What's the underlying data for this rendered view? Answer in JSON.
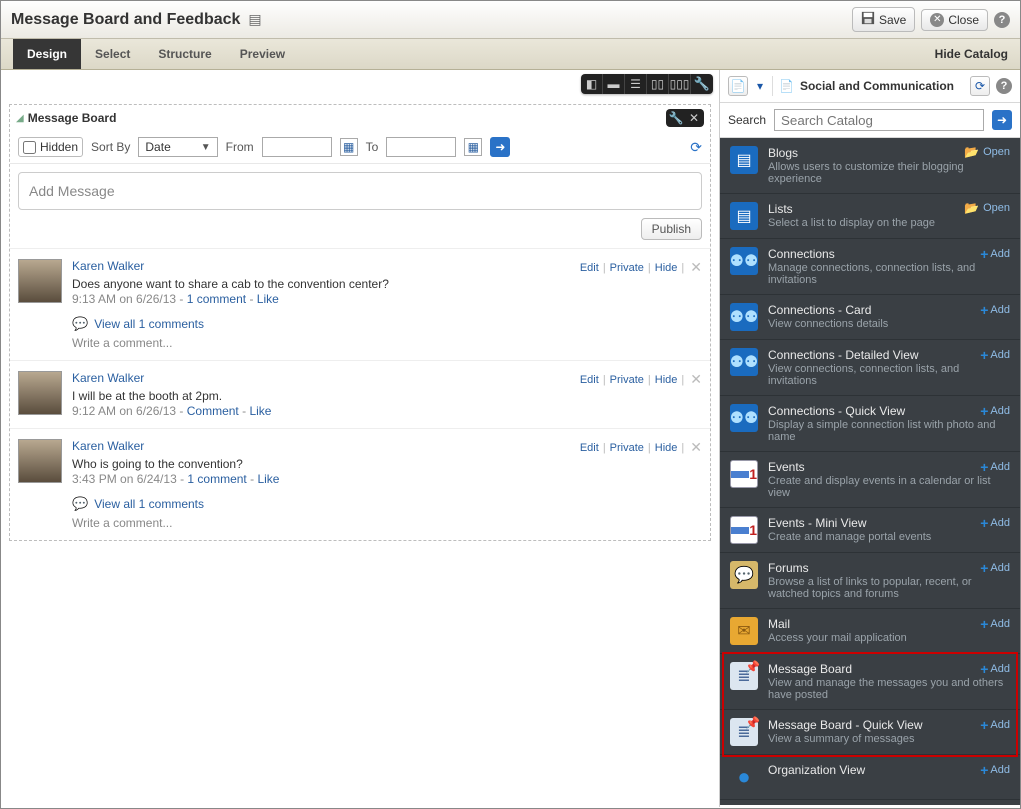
{
  "header": {
    "title": "Message Board and Feedback",
    "save": "Save",
    "close": "Close"
  },
  "tabs": {
    "items": [
      "Design",
      "Select",
      "Structure",
      "Preview"
    ],
    "hide_catalog": "Hide Catalog"
  },
  "panel": {
    "title": "Message Board",
    "hidden_label": "Hidden",
    "sortby_label": "Sort By",
    "sortby_value": "Date",
    "from_label": "From",
    "to_label": "To",
    "add_placeholder": "Add Message",
    "publish": "Publish"
  },
  "post_actions": {
    "edit": "Edit",
    "private": "Private",
    "hide": "Hide",
    "like": "Like",
    "comment": "Comment",
    "view_all": "View all 1 comments",
    "one_comment": "1 comment",
    "write": "Write a comment..."
  },
  "posts": [
    {
      "author": "Karen Walker",
      "body": "Does anyone want to share a cab to the convention center?",
      "time": "9:13 AM on 6/26/13",
      "has_comments": true
    },
    {
      "author": "Karen Walker",
      "body": "I will be at the booth at 2pm.",
      "time": "9:12 AM on 6/26/13",
      "has_comments": false
    },
    {
      "author": "Karen Walker",
      "body": "Who is going to the convention?",
      "time": "3:43 PM on 6/24/13",
      "has_comments": true
    }
  ],
  "catalog": {
    "title": "Social and Communication",
    "search_label": "Search",
    "search_placeholder": "Search Catalog",
    "open": "Open",
    "add": "Add",
    "items": [
      {
        "name": "Blogs",
        "desc": "Allows users to customize their blogging experience",
        "action": "open",
        "icon": "blue"
      },
      {
        "name": "Lists",
        "desc": "Select a list to display on the page",
        "action": "open",
        "icon": "blue"
      },
      {
        "name": "Connections",
        "desc": "Manage connections, connection lists, and invitations",
        "action": "add",
        "icon": "people"
      },
      {
        "name": "Connections - Card",
        "desc": "View connections details",
        "action": "add",
        "icon": "people"
      },
      {
        "name": "Connections - Detailed View",
        "desc": "View connections, connection lists, and invitations",
        "action": "add",
        "icon": "people"
      },
      {
        "name": "Connections - Quick View",
        "desc": "Display a simple connection list with photo and name",
        "action": "add",
        "icon": "people"
      },
      {
        "name": "Events",
        "desc": "Create and display events in a calendar or list view",
        "action": "add",
        "icon": "cal"
      },
      {
        "name": "Events - Mini View",
        "desc": "Create and manage portal events",
        "action": "add",
        "icon": "cal"
      },
      {
        "name": "Forums",
        "desc": "Browse a list of links to popular, recent, or watched topics and forums",
        "action": "add",
        "icon": "forum"
      },
      {
        "name": "Mail",
        "desc": "Access your mail application",
        "action": "add",
        "icon": "mail"
      },
      {
        "name": "Message Board",
        "desc": "View and manage the messages you and others have posted",
        "action": "add",
        "icon": "doc"
      },
      {
        "name": "Message Board - Quick View",
        "desc": "View a summary of messages",
        "action": "add",
        "icon": "doc"
      },
      {
        "name": "Organization View",
        "desc": "",
        "action": "add",
        "icon": "person"
      }
    ]
  }
}
